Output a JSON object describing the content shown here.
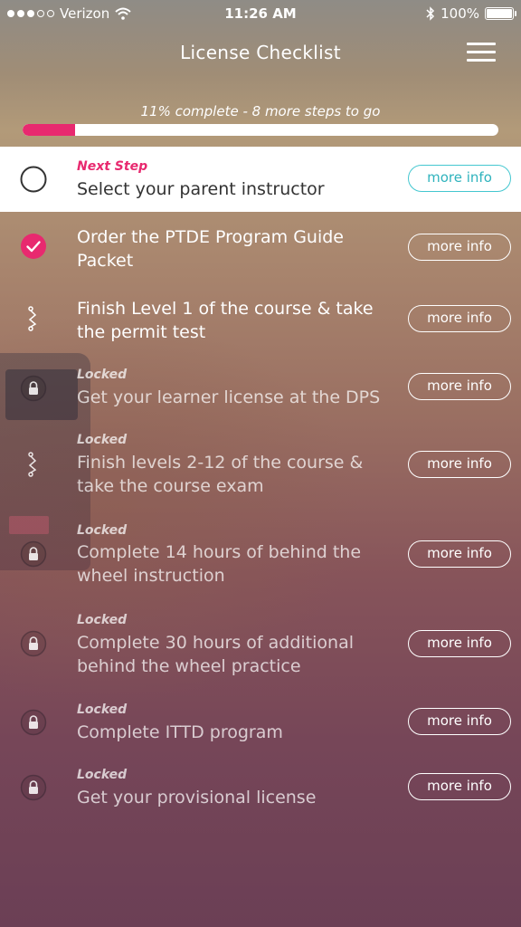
{
  "status_bar": {
    "carrier": "Verizon",
    "time": "11:26 AM",
    "battery": "100%",
    "icons": [
      "signal-dots",
      "wifi-icon",
      "bluetooth-icon",
      "battery-icon"
    ]
  },
  "header": {
    "title": "License Checklist",
    "menu_icon": "hamburger-menu-icon"
  },
  "progress": {
    "text": "11% complete - 8 more steps to go",
    "fraction": 0.11,
    "color": "#e8296f"
  },
  "steps": [
    {
      "status": "next",
      "kicker": "Next Step",
      "label": "Select your parent instructor",
      "button": "more info",
      "icon": "empty-circle-icon"
    },
    {
      "status": "done",
      "kicker": "",
      "label": "Order the PTDE Program Guide Packet",
      "button": "more info",
      "icon": "check-circle-icon"
    },
    {
      "status": "available",
      "kicker": "",
      "label": "Finish Level 1 of the course & take the permit test",
      "button": "more info",
      "icon": "zigzag-path-icon"
    },
    {
      "status": "locked",
      "kicker": "Locked",
      "label": "Get your learner license at the DPS",
      "button": "more info",
      "icon": "lock-icon"
    },
    {
      "status": "locked",
      "kicker": "Locked",
      "label": "Finish levels 2-12 of the course & take the course exam",
      "button": "more info",
      "icon": "zigzag-path-icon"
    },
    {
      "status": "locked",
      "kicker": "Locked",
      "label": "Complete 14 hours of behind the wheel instruction",
      "button": "more info",
      "icon": "lock-icon"
    },
    {
      "status": "locked",
      "kicker": "Locked",
      "label": "Complete 30 hours of additional behind the wheel practice",
      "button": "more info",
      "icon": "lock-icon"
    },
    {
      "status": "locked",
      "kicker": "Locked",
      "label": "Complete ITTD program",
      "button": "more info",
      "icon": "lock-icon"
    },
    {
      "status": "locked",
      "kicker": "Locked",
      "label": "Get your provisional license",
      "button": "more info",
      "icon": "lock-icon"
    }
  ],
  "colors": {
    "accent_pink": "#e8296f",
    "button_teal": "#44c7d0"
  }
}
